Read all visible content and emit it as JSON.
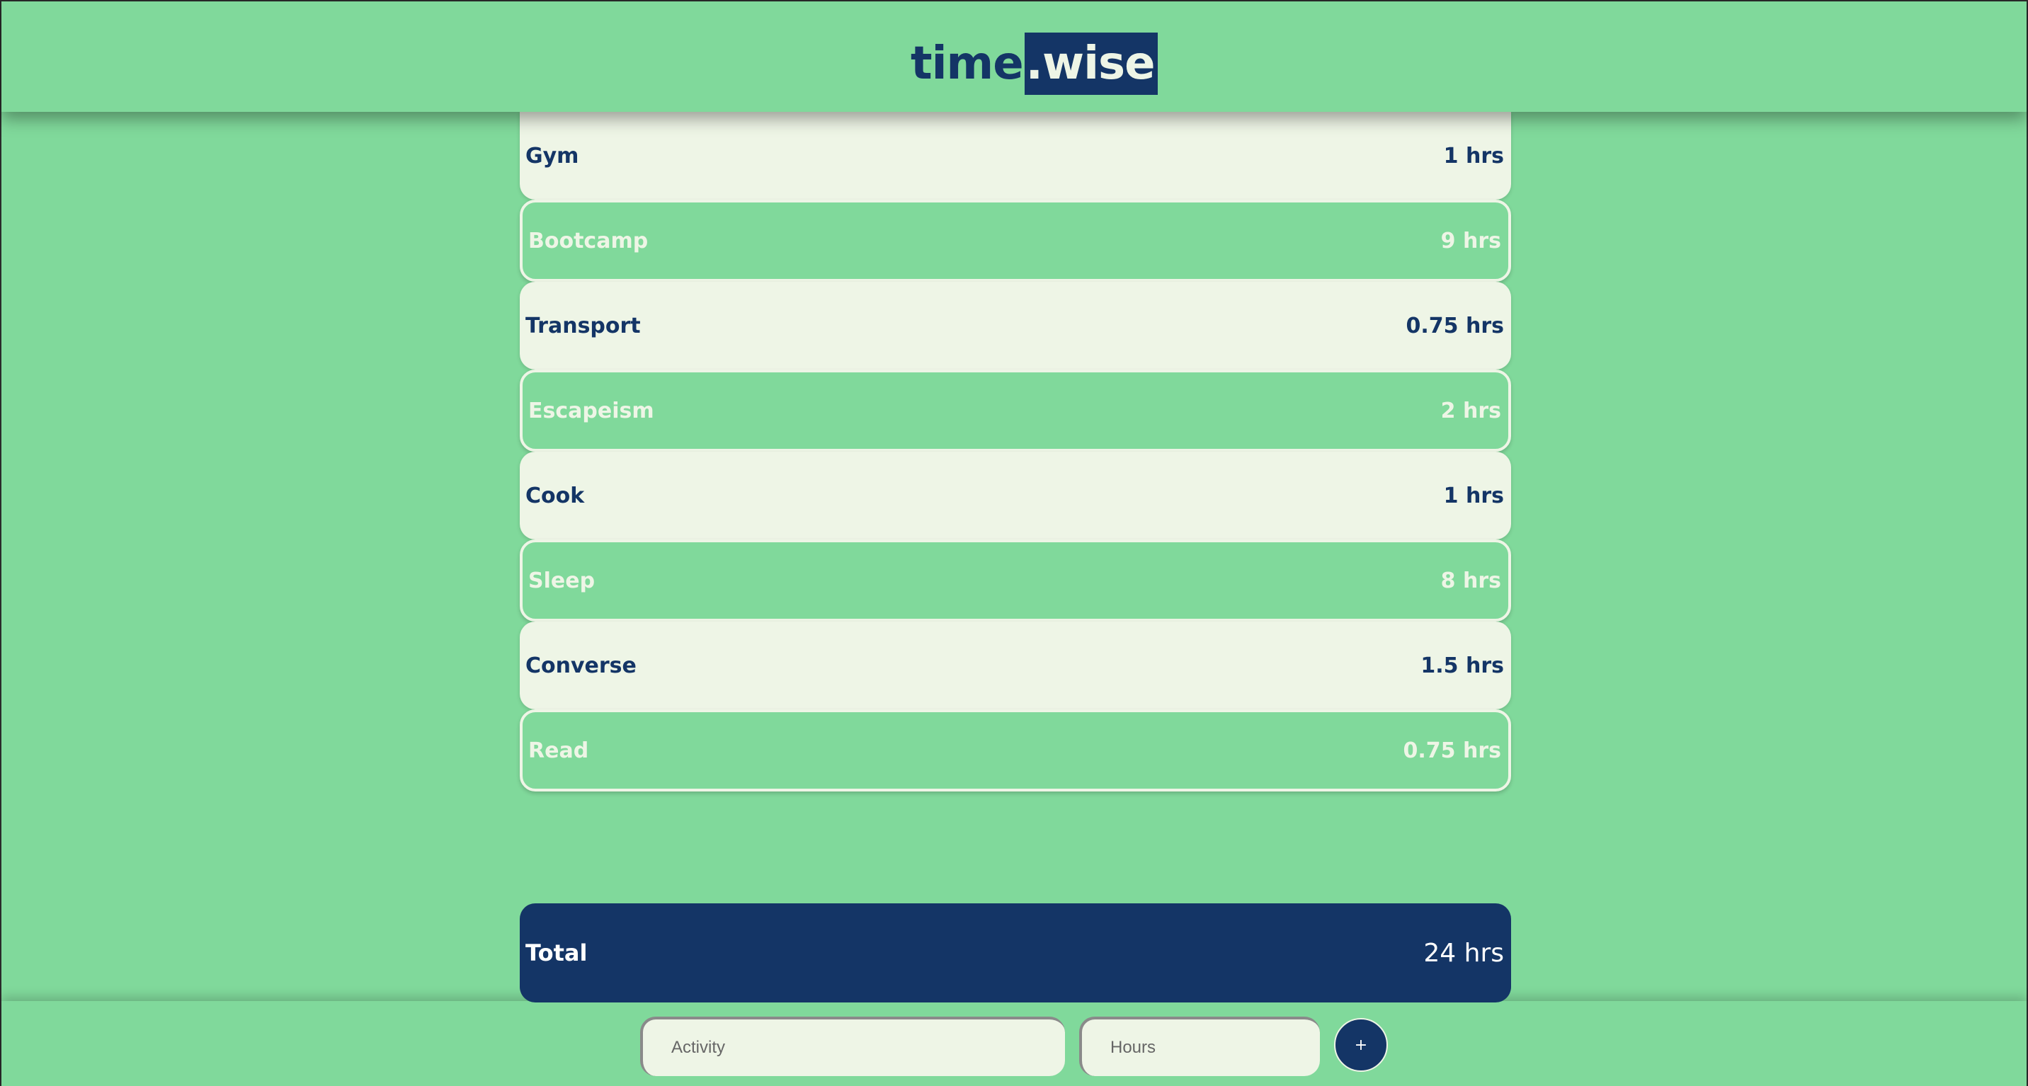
{
  "header": {
    "logo_left": "time",
    "logo_right": ".wise"
  },
  "activities": [
    {
      "name": "Gym",
      "hours": "1 hrs"
    },
    {
      "name": "Bootcamp",
      "hours": "9 hrs"
    },
    {
      "name": "Transport",
      "hours": "0.75 hrs"
    },
    {
      "name": "Escapeism",
      "hours": "2 hrs"
    },
    {
      "name": "Cook",
      "hours": "1 hrs"
    },
    {
      "name": "Sleep",
      "hours": "8 hrs"
    },
    {
      "name": "Converse",
      "hours": "1.5 hrs"
    },
    {
      "name": "Read",
      "hours": "0.75 hrs"
    }
  ],
  "total": {
    "label": "Total",
    "value": "24 hrs"
  },
  "form": {
    "activity_placeholder": "Activity",
    "hours_placeholder": "Hours",
    "add_label": "+"
  },
  "colors": {
    "background": "#80d99b",
    "navy": "#143566",
    "cream": "#eef5e6"
  }
}
